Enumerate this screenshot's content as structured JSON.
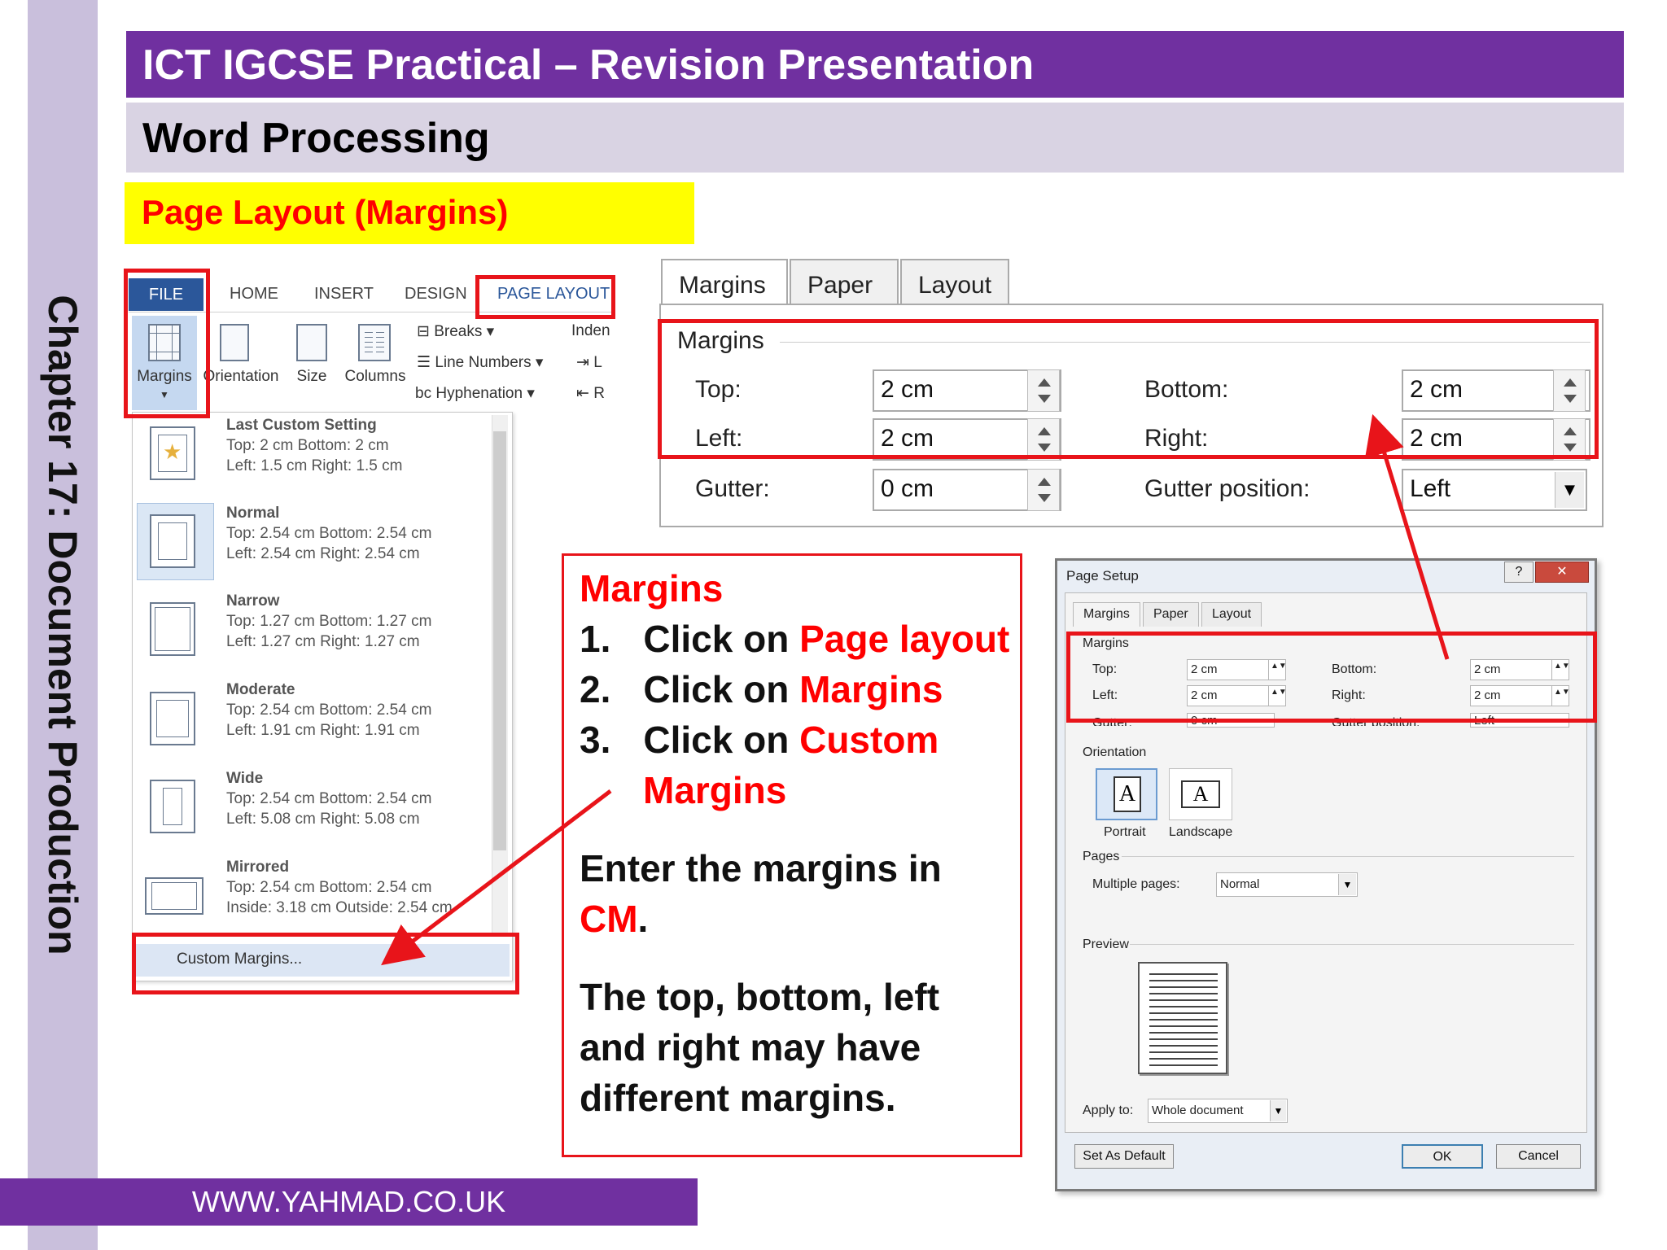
{
  "chapter_label": "Chapter 17: Document Production",
  "title": "ICT IGCSE Practical – Revision Presentation",
  "subtitle": "Word Processing",
  "section": "Page Layout (Margins)",
  "footer": "WWW.YAHMAD.CO.UK",
  "ribbon": {
    "tabs": [
      "FILE",
      "HOME",
      "INSERT",
      "DESIGN",
      "PAGE LAYOUT"
    ],
    "buttons": [
      "Margins",
      "Orientation",
      "Size",
      "Columns"
    ],
    "small_items": [
      "Breaks",
      "Line Numbers",
      "Hyphenation"
    ],
    "indent_label": "Inden",
    "indent_l": "L",
    "indent_r": "R"
  },
  "margins_menu": {
    "options": [
      {
        "name": "Last Custom Setting",
        "row1": "Top:      2 cm          Bottom: 2 cm",
        "row2": "Left:      1.5 cm       Right:     1.5 cm"
      },
      {
        "name": "Normal",
        "row1": "Top:      2.54 cm     Bottom: 2.54 cm",
        "row2": "Left:      2.54 cm     Right:     2.54 cm"
      },
      {
        "name": "Narrow",
        "row1": "Top:      1.27 cm     Bottom: 1.27 cm",
        "row2": "Left:      1.27 cm     Right:     1.27 cm"
      },
      {
        "name": "Moderate",
        "row1": "Top:      2.54 cm     Bottom: 2.54 cm",
        "row2": "Left:      1.91 cm     Right:     1.91 cm"
      },
      {
        "name": "Wide",
        "row1": "Top:      2.54 cm     Bottom: 2.54 cm",
        "row2": "Left:      5.08 cm     Right:     5.08 cm"
      },
      {
        "name": "Mirrored",
        "row1": "Top:      2.54 cm     Bottom: 2.54 cm",
        "row2": "Inside:  3.18 cm     Outside: 2.54 cm"
      }
    ],
    "custom": "Custom Margins..."
  },
  "big_dialog": {
    "tabs": [
      "Margins",
      "Paper",
      "Layout"
    ],
    "group": "Margins",
    "top_label": "Top:",
    "top_value": "2 cm",
    "bottom_label": "Bottom:",
    "bottom_value": "2 cm",
    "left_label": "Left:",
    "left_value": "2 cm",
    "right_label": "Right:",
    "right_value": "2 cm",
    "gutter_label": "Gutter:",
    "gutter_value": "0 cm",
    "gutter_pos_label": "Gutter position:",
    "gutter_pos_value": "Left"
  },
  "info": {
    "heading": "Margins",
    "steps": [
      {
        "num": "1.",
        "text": "Click on ",
        "highlight": "Page layout"
      },
      {
        "num": "2.",
        "text": "Click on ",
        "highlight": "Margins"
      },
      {
        "num": "3.",
        "text": "Click on ",
        "highlight": "Custom"
      }
    ],
    "step3_cont": "Margins",
    "para1_a": "Enter the margins in",
    "para1_b": "CM",
    "para1_c": ".",
    "para2_l1": "The top, bottom, left",
    "para2_l2": "and right may have",
    "para2_l3": "different margins."
  },
  "small_dialog": {
    "title": "Page Setup",
    "help": "?",
    "close": "✕",
    "tabs": [
      "Margins",
      "Paper",
      "Layout"
    ],
    "margins_group": "Margins",
    "top_label": "Top:",
    "top_value": "2 cm",
    "bottom_label": "Bottom:",
    "bottom_value": "2 cm",
    "left_label": "Left:",
    "left_value": "2 cm",
    "right_label": "Right:",
    "right_value": "2 cm",
    "gutter_label": "Gutter:",
    "gutter_value": "0 cm",
    "gutter_pos_label": "Gutter position:",
    "gutter_pos_value": "Left",
    "orientation_group": "Orientation",
    "portrait": "Portrait",
    "landscape": "Landscape",
    "pages_group": "Pages",
    "multiple_pages_label": "Multiple pages:",
    "multiple_pages_value": "Normal",
    "preview_group": "Preview",
    "apply_label": "Apply to:",
    "apply_value": "Whole document",
    "set_default": "Set As Default",
    "ok": "OK",
    "cancel": "Cancel"
  },
  "colors": {
    "purple": "#7030a0",
    "lavender": "#c9bfdc",
    "yellow": "#ffff00",
    "red": "#e8141a",
    "word_blue": "#2b579a"
  }
}
